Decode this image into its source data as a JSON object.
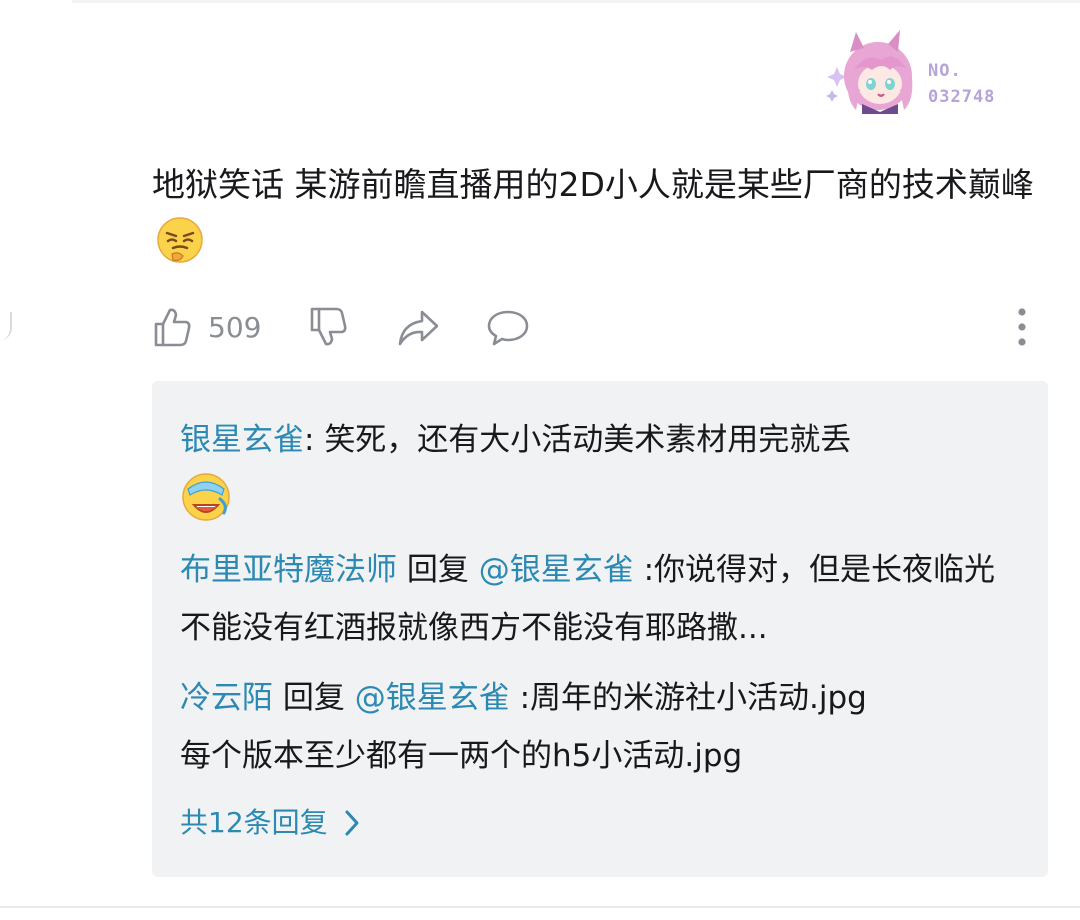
{
  "fan_badge": {
    "line1": "NO.",
    "line2": "032748",
    "text_color": "#b4a4d8"
  },
  "comment": {
    "text": "地狱笑话 某游前瞻直播用的2D小人就是某些厂商的技术巅峰",
    "emoji": "facepalm-laughing-emoji"
  },
  "actions": {
    "like_icon": "thumbs-up-icon",
    "like_count": "509",
    "dislike_icon": "thumbs-down-icon",
    "share_icon": "share-arrow-icon",
    "reply_icon": "speech-bubble-icon",
    "more_icon": "vertical-dots-icon"
  },
  "replies": {
    "items": [
      {
        "user": "银星玄雀",
        "separator": ": ",
        "text": "笑死，还有大小活动美术素材用完就丢",
        "emoji": "crying-laughing-emoji"
      },
      {
        "user": "布里亚特魔法师",
        "reply_word": " 回复 ",
        "mention": "@银星玄雀",
        "text": " :你说得对，但是长夜临光不能没有红酒报就像西方不能没有耶路撒..."
      },
      {
        "user": "冷云陌",
        "reply_word": " 回复 ",
        "mention": "@银星玄雀",
        "text": " :周年的米游社小活动.jpg",
        "text2": "每个版本至少都有一两个的h5小活动.jpg"
      }
    ],
    "more_label": "共12条回复",
    "more_icon": "chevron-right-icon"
  },
  "colors": {
    "username": "#2b89b3",
    "icon_gray": "#8a8e94",
    "reply_bg": "#f1f2f3",
    "text": "#18191c"
  }
}
